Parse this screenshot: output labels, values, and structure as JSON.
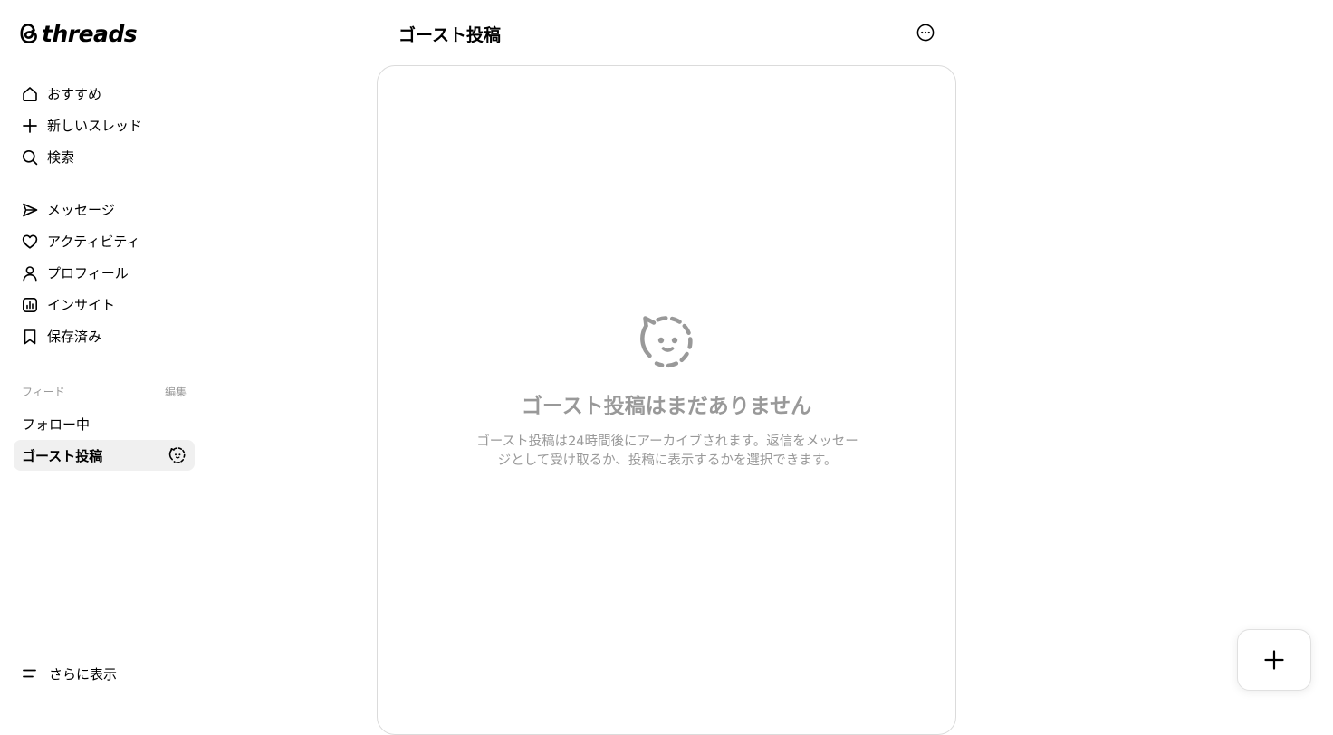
{
  "app": {
    "logo_text": "threads"
  },
  "nav": {
    "primary": [
      {
        "label": "おすすめ",
        "icon": "home-icon"
      },
      {
        "label": "新しいスレッド",
        "icon": "plus-icon"
      },
      {
        "label": "検索",
        "icon": "search-icon"
      }
    ],
    "secondary": [
      {
        "label": "メッセージ",
        "icon": "send-icon"
      },
      {
        "label": "アクティビティ",
        "icon": "heart-icon"
      },
      {
        "label": "プロフィール",
        "icon": "person-icon"
      },
      {
        "label": "インサイト",
        "icon": "insights-icon"
      },
      {
        "label": "保存済み",
        "icon": "bookmark-icon"
      }
    ]
  },
  "feeds": {
    "heading": "フィード",
    "edit_label": "編集",
    "items": [
      {
        "label": "フォロー中",
        "active": false
      },
      {
        "label": "ゴースト投稿",
        "active": true,
        "icon": "ghost-icon"
      }
    ]
  },
  "more": {
    "label": "さらに表示",
    "icon": "menu-icon"
  },
  "main": {
    "title": "ゴースト投稿",
    "options_icon": "more-options-icon",
    "empty_state": {
      "icon": "ghost-icon",
      "title": "ゴースト投稿はまだありません",
      "description": "ゴースト投稿は24時間後にアーカイブされます。返信をメッセージとして受け取るか、投稿に表示するかを選択できます。"
    }
  },
  "fab": {
    "icon": "plus-icon"
  }
}
